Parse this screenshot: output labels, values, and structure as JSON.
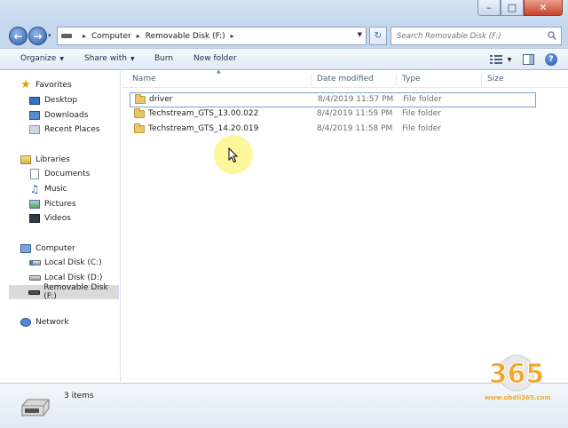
{
  "window": {
    "min_glyph": "–",
    "max_glyph": "□",
    "close_glyph": "✕"
  },
  "address_bar": {
    "breadcrumbs": [
      "Computer",
      "Removable Disk (F:)"
    ],
    "separator": "▸"
  },
  "search": {
    "placeholder": "Search Removable Disk (F:)"
  },
  "toolbar": {
    "organize": "Organize",
    "share_with": "Share with",
    "burn": "Burn",
    "new_folder": "New folder"
  },
  "sidebar": {
    "favorites": {
      "label": "Favorites",
      "items": [
        "Desktop",
        "Downloads",
        "Recent Places"
      ]
    },
    "libraries": {
      "label": "Libraries",
      "items": [
        "Documents",
        "Music",
        "Pictures",
        "Videos"
      ]
    },
    "computer": {
      "label": "Computer",
      "items": [
        "Local Disk (C:)",
        "Local Disk (D:)",
        "Removable Disk (F:)"
      ],
      "selected": "Removable Disk (F:)"
    },
    "network": {
      "label": "Network"
    }
  },
  "columns": [
    "Name",
    "Date modified",
    "Type",
    "Size"
  ],
  "files": [
    {
      "name": "driver",
      "date": "8/4/2019 11:57 PM",
      "type": "File folder",
      "selected": true
    },
    {
      "name": "Techstream_GTS_13.00.022",
      "date": "8/4/2019 11:59 PM",
      "type": "File folder",
      "selected": false
    },
    {
      "name": "Techstream_GTS_14.20.019",
      "date": "8/4/2019 11:58 PM",
      "type": "File folder",
      "selected": false
    }
  ],
  "status": {
    "item_count": "3 items"
  },
  "watermark": {
    "logo_text": "365",
    "url": "www.obdii365.com"
  },
  "colors": {
    "accent": "#2b5ea8",
    "folder": "#e7c76b",
    "selection_border": "#7da2ce",
    "watermark": "#f2a72a"
  }
}
